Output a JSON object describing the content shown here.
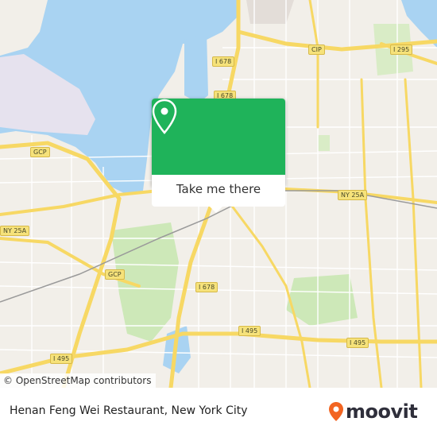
{
  "map": {
    "road_labels": [
      {
        "id": "i678-top",
        "text": "I 678"
      },
      {
        "id": "cip",
        "text": "CIP"
      },
      {
        "id": "i295",
        "text": "I 295"
      },
      {
        "id": "i678-mid",
        "text": "I 678"
      },
      {
        "id": "gcp-left",
        "text": "GCP"
      },
      {
        "id": "ny25a-right",
        "text": "NY 25A"
      },
      {
        "id": "ny25a-left",
        "text": "NY 25A"
      },
      {
        "id": "gcp-mid",
        "text": "GCP"
      },
      {
        "id": "i678-low",
        "text": "I 678"
      },
      {
        "id": "i495-mid",
        "text": "I 495"
      },
      {
        "id": "i495-right",
        "text": "I 495"
      },
      {
        "id": "i495-left",
        "text": "I 495"
      }
    ],
    "colors": {
      "land": "#f2efe9",
      "water": "#a9d3f2",
      "park": "#cde8b8",
      "highway": "#f7d864",
      "street": "#ffffff",
      "accent": "#1fb35a"
    }
  },
  "popup": {
    "button_label": "Take me there",
    "icon": "location-pin-icon"
  },
  "attribution": {
    "text": "© OpenStreetMap contributors"
  },
  "footer": {
    "place_name": "Henan Feng Wei Restaurant, New York City",
    "brand": "moovit",
    "brand_color": "#f26522"
  }
}
